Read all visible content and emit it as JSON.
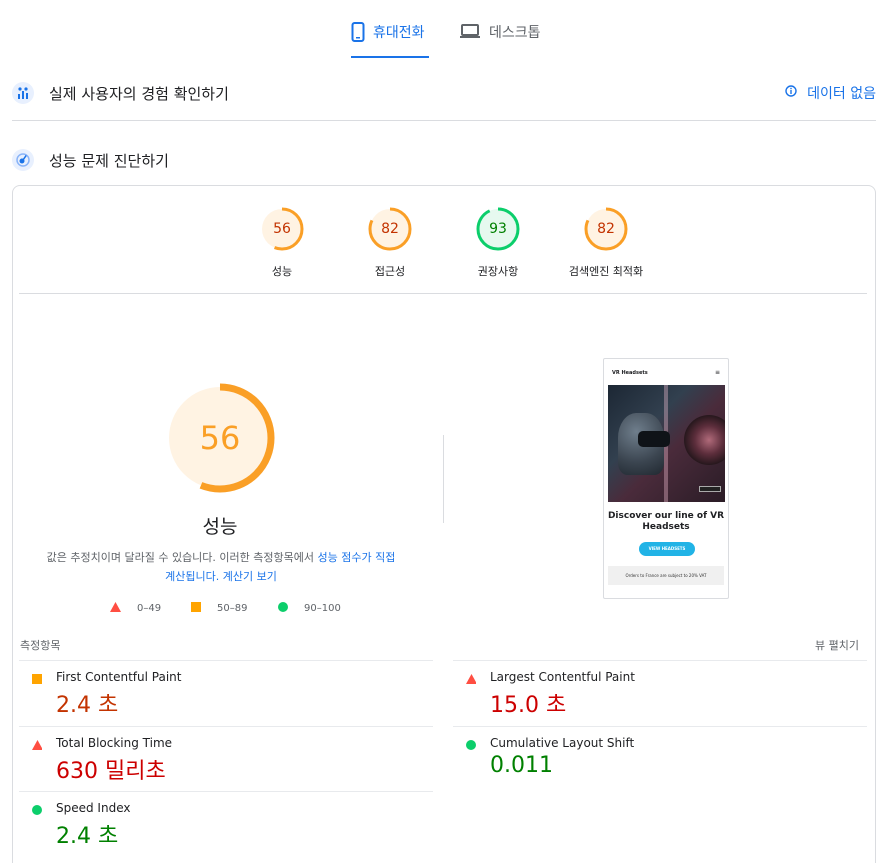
{
  "tabs": [
    {
      "label": "휴대전화",
      "icon": "mobile-icon",
      "active": true
    },
    {
      "label": "데스크톱",
      "icon": "laptop-icon",
      "active": false
    }
  ],
  "field_section": {
    "title": "실제 사용자의 경험 확인하기",
    "no_data": "데이터 없음"
  },
  "lab_section": {
    "title": "성능 문제 진단하기"
  },
  "category_scores": [
    {
      "score": "56",
      "label": "성능",
      "status": "average"
    },
    {
      "score": "82",
      "label": "접근성",
      "status": "average"
    },
    {
      "score": "93",
      "label": "권장사항",
      "status": "pass"
    },
    {
      "score": "82",
      "label": "검색엔진 최적화",
      "status": "average"
    }
  ],
  "performance": {
    "score": "56",
    "score_fraction": 0.56,
    "title": "성능",
    "desc_prefix": "값은 추정치이며 달라질 수 있습니다. 이러한 측정항목에서 ",
    "desc_link1": "성능 점수가 직접 계산됩니다.",
    "desc_link2": "계산기 보기"
  },
  "legend": [
    {
      "range": "0–49",
      "shape": "triangle",
      "color": "#ff4e42"
    },
    {
      "range": "50–89",
      "shape": "square",
      "color": "#ffa400"
    },
    {
      "range": "90–100",
      "shape": "circle",
      "color": "#0cce6b"
    }
  ],
  "screenshot": {
    "brand": "VR Headsets",
    "headline": "Discover our line of VR Headsets",
    "button": "VIEW HEADSETS",
    "note": "Orders to France are subject to 20% VAT"
  },
  "metrics_label": "측정항목",
  "expand_label": "뷰 펼치기",
  "metrics": [
    {
      "name": "First Contentful Paint",
      "value": "2.4 초",
      "status": "average"
    },
    {
      "name": "Largest Contentful Paint",
      "value": "15.0 초",
      "status": "fail"
    },
    {
      "name": "Total Blocking Time",
      "value": "630 밀리초",
      "status": "fail"
    },
    {
      "name": "Cumulative Layout Shift",
      "value": "0.011",
      "status": "pass"
    },
    {
      "name": "Speed Index",
      "value": "2.4 초",
      "status": "pass"
    }
  ],
  "colors": {
    "accent": "#1a73e8",
    "average": "#fa9f26",
    "pass": "#0cce6b",
    "fail": "#ff4e42"
  }
}
